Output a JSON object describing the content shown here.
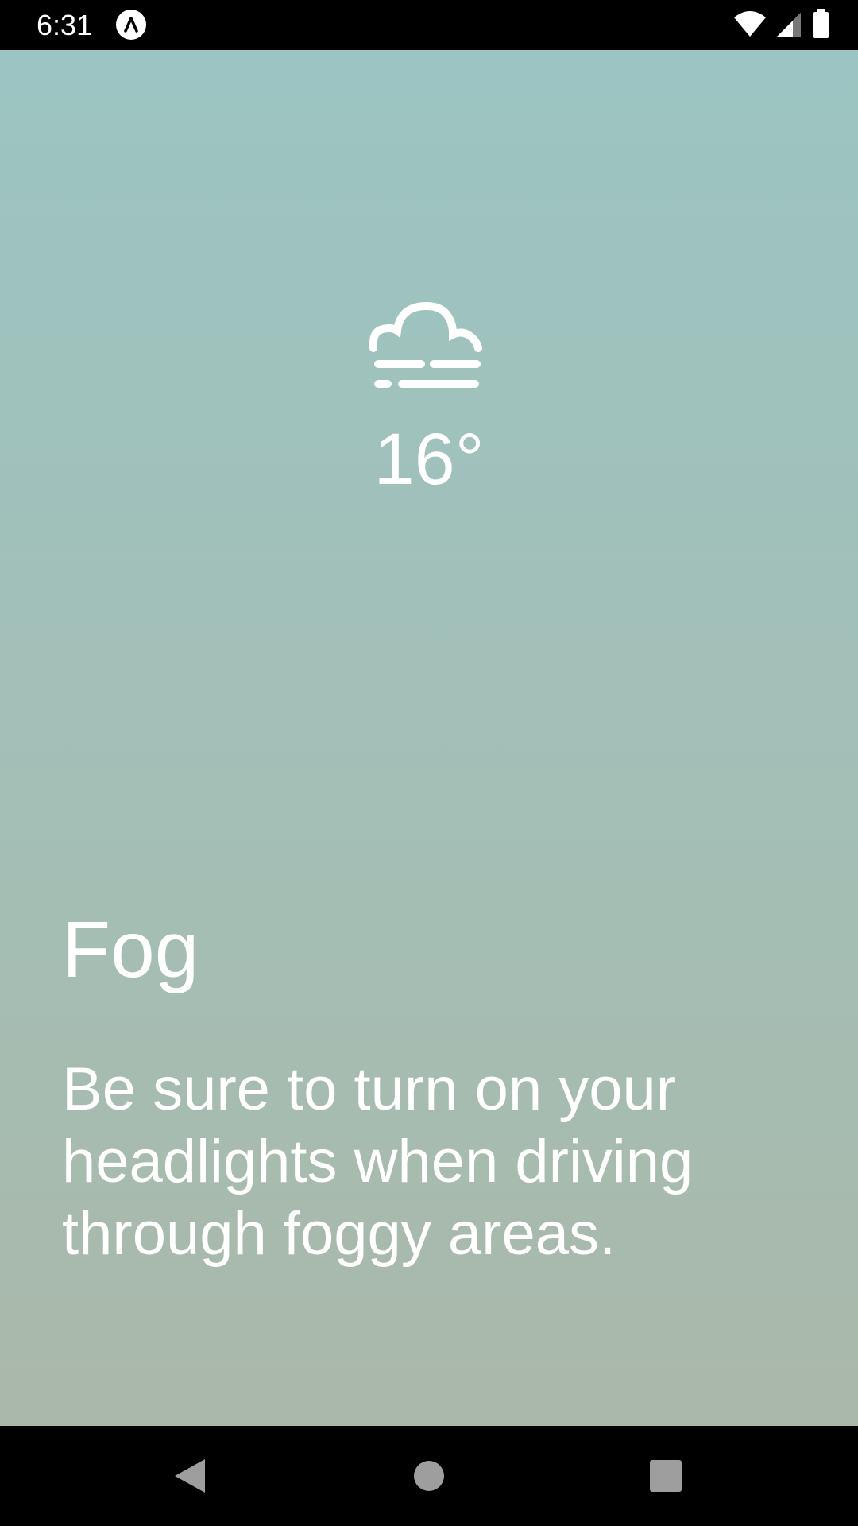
{
  "status_bar": {
    "time": "6:31",
    "app_icon": "a-letter-icon",
    "icons": [
      "wifi-icon",
      "cell-signal-icon",
      "battery-icon"
    ]
  },
  "weather": {
    "icon": "fog-icon",
    "temperature": "16°",
    "condition": "Fog",
    "message": "Be sure to turn on your headlights when driving through foggy areas."
  },
  "nav_bar": {
    "buttons": [
      "back-icon",
      "home-icon",
      "recents-icon"
    ]
  },
  "colors": {
    "gradient_top": "#9cc4c2",
    "gradient_bottom": "#aab8aa",
    "text": "#ffffff",
    "nav_icon": "#9e9e9e"
  }
}
